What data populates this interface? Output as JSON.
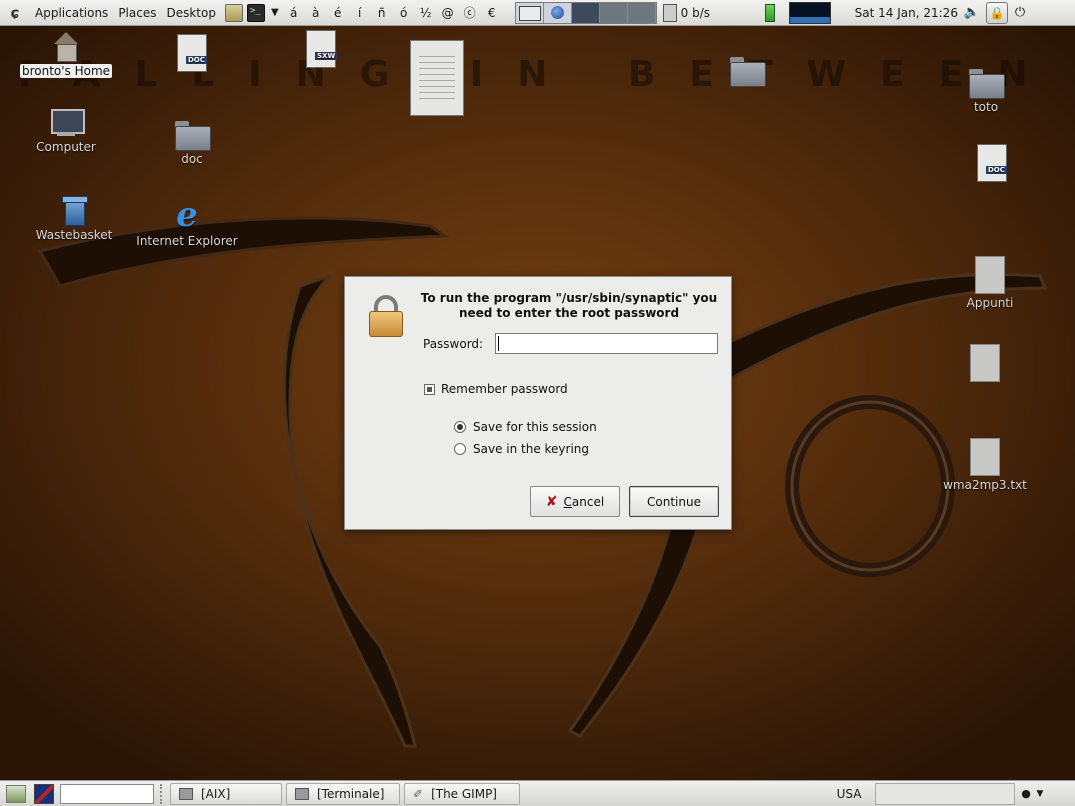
{
  "top_panel": {
    "menus": [
      "Applications",
      "Places",
      "Desktop"
    ],
    "special_chars": [
      "á",
      "à",
      "é",
      "í",
      "ñ",
      "ó",
      "½",
      "@",
      "ⓒ",
      "€"
    ],
    "net_speed": "0 b/s",
    "clock": "Sat 14 Jan, 21:26",
    "icons": {
      "logo": "gnome-foot-icon",
      "volume": "volume-icon",
      "lock": "lock-screen-icon"
    }
  },
  "desktop": {
    "wallpaper_text": "FALLING IN BETWEEN",
    "icons": [
      {
        "label": "bronto's Home"
      },
      {
        "label": "Computer"
      },
      {
        "label": "Wastebasket"
      },
      {
        "label": "Internet Explorer"
      },
      {
        "label": "doc"
      },
      {
        "label": "toto"
      },
      {
        "label": "Appunti"
      },
      {
        "label": "wma2mp3.txt"
      }
    ]
  },
  "dialog": {
    "message": "To run the program \"/usr/sbin/synaptic\" you need to enter the root password",
    "password_label": "Password:",
    "password_value": "",
    "remember_label": "Remember password",
    "remember_checked": true,
    "options": [
      {
        "label": "Save for this session",
        "selected": true
      },
      {
        "label": "Save in the keyring",
        "selected": false
      }
    ],
    "cancel_label_pre": "",
    "cancel_label_mnemonic": "C",
    "cancel_label_post": "ancel",
    "continue_label": "Continue"
  },
  "bottom_panel": {
    "tasks": [
      "[AIX]",
      "[Terminale]",
      "[The GIMP]"
    ],
    "keyboard_layout": "USA"
  }
}
